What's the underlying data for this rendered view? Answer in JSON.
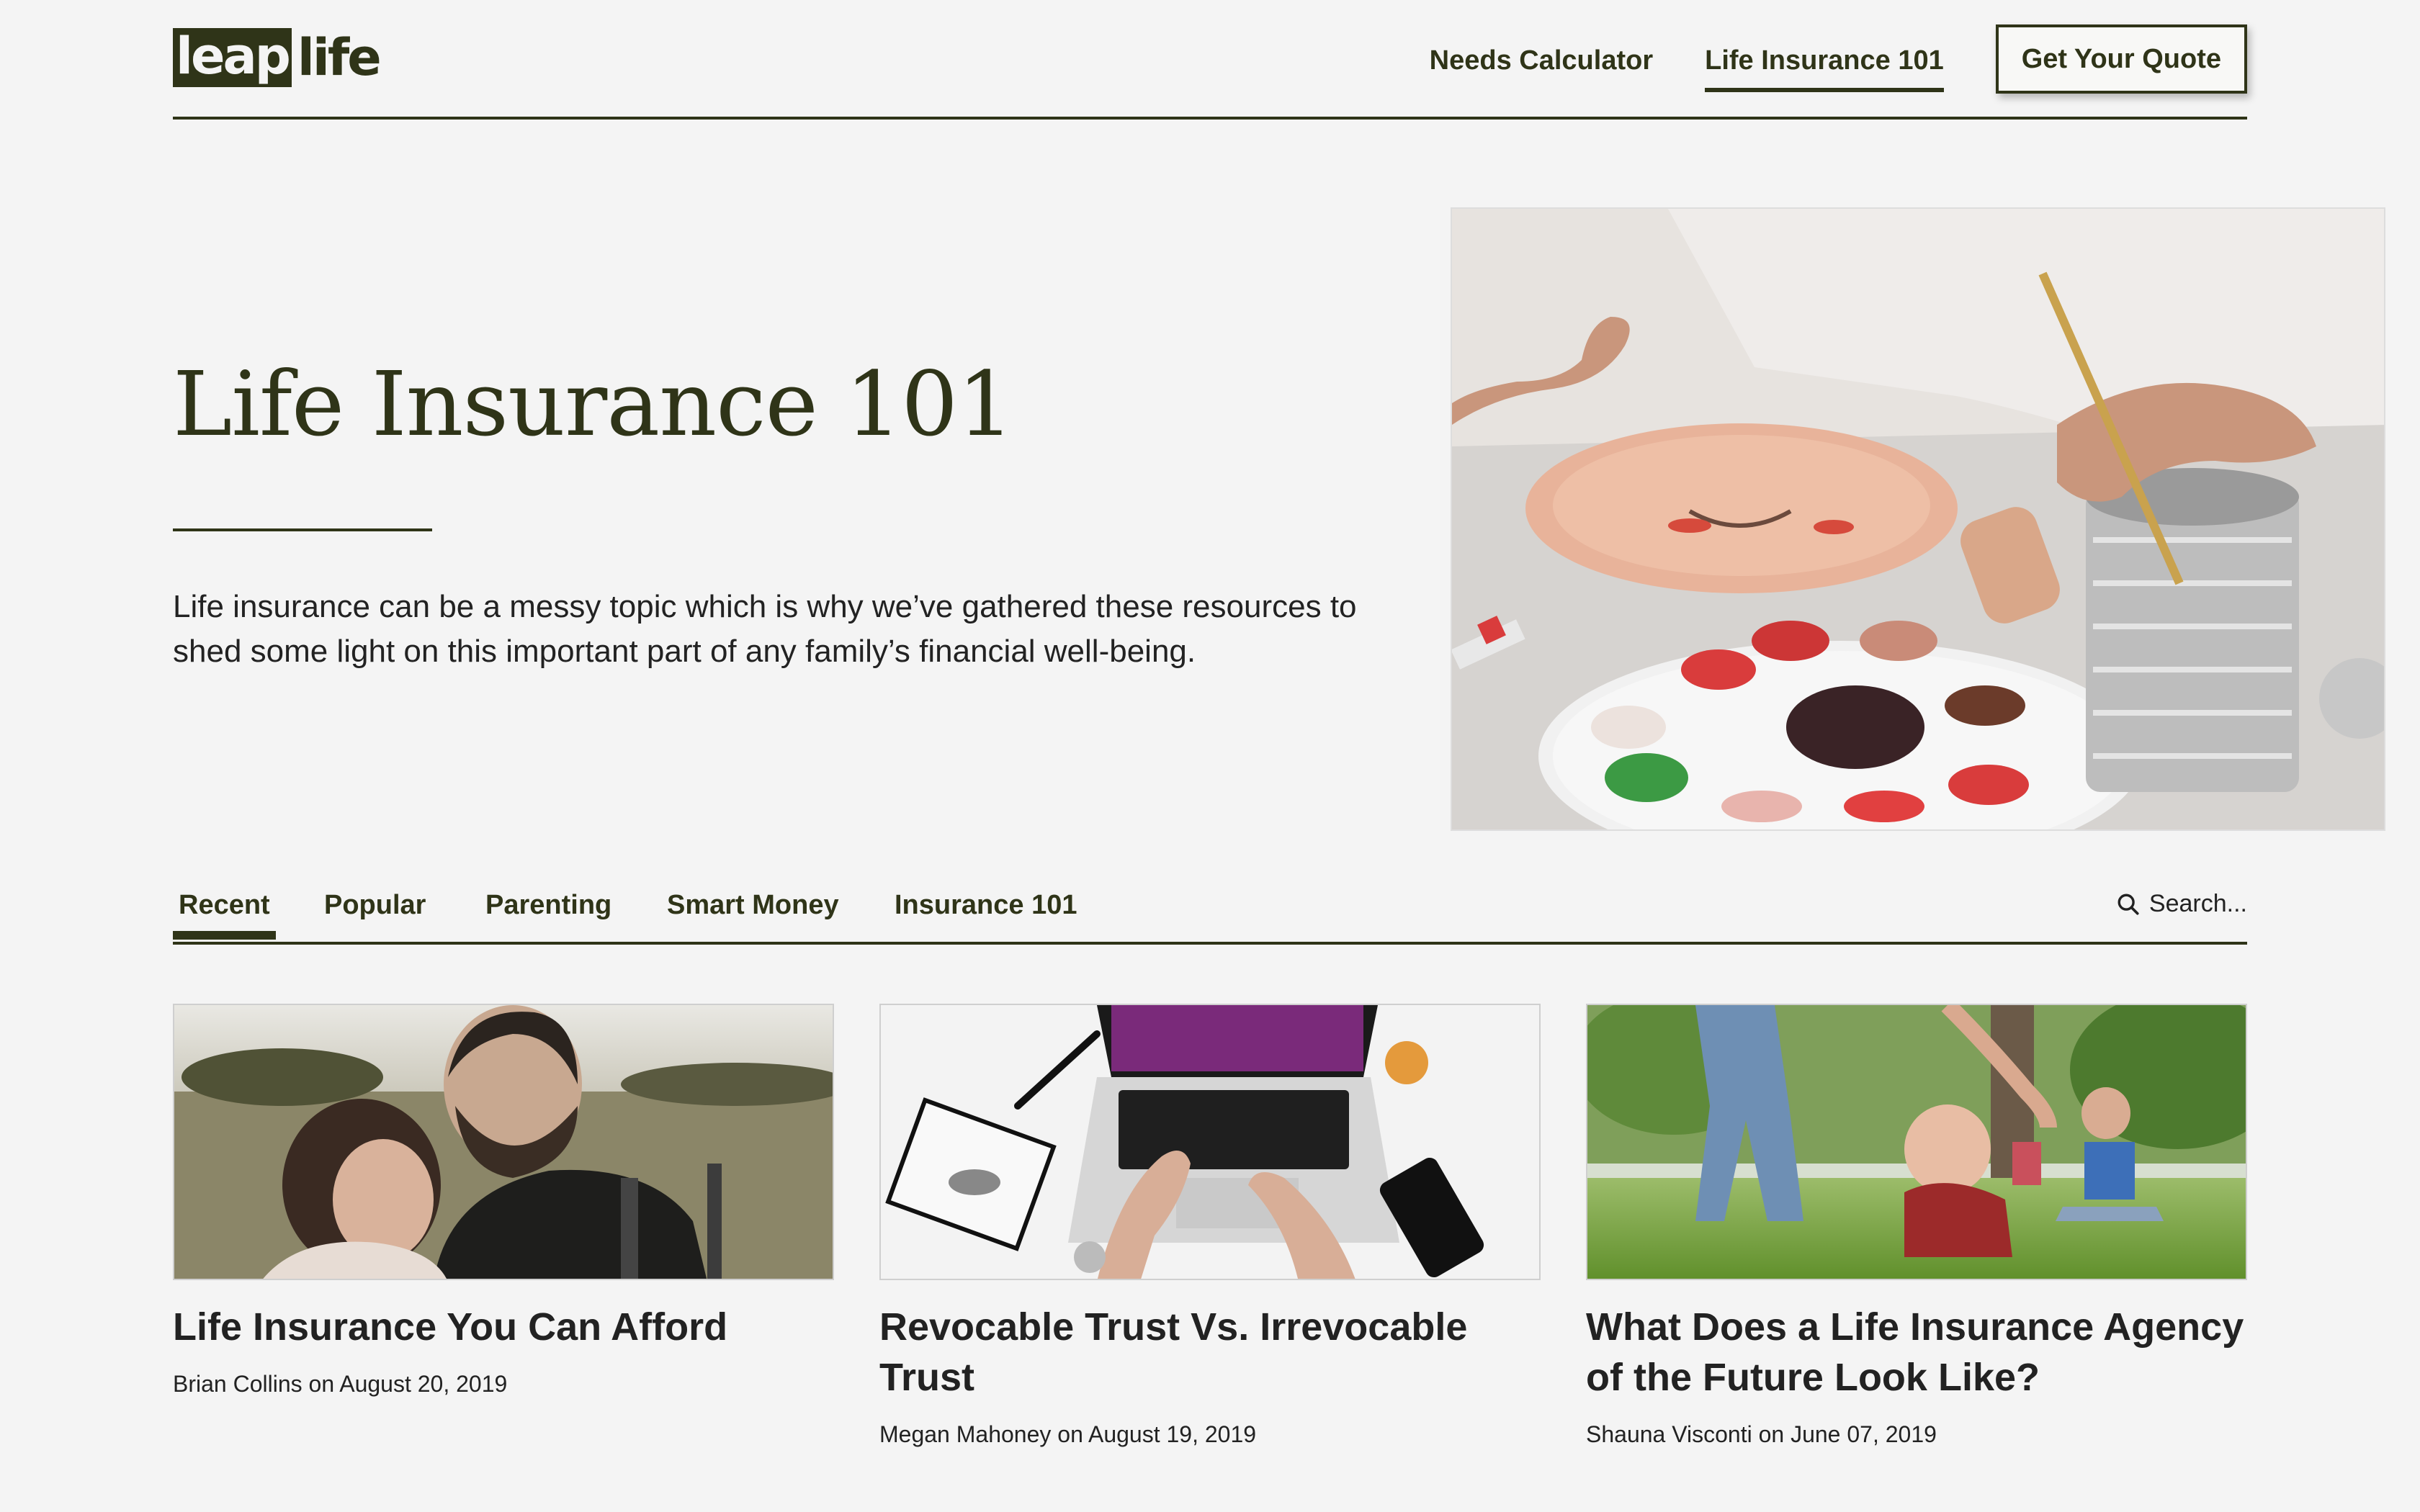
{
  "brand": {
    "logo_part1": "leap",
    "logo_part2": "life"
  },
  "nav": {
    "items": [
      {
        "label": "Needs Calculator"
      },
      {
        "label": "Life Insurance 101",
        "active": true
      }
    ],
    "cta": "Get Your Quote"
  },
  "hero": {
    "title": "Life Insurance 101",
    "description": "Life insurance can be a messy topic which is why we’ve gathered these resources to shed some light on this important part of any family’s financial well-being."
  },
  "tabs": {
    "items": [
      "Recent",
      "Popular",
      "Parenting",
      "Smart Money",
      "Insurance 101"
    ],
    "active": "Recent",
    "search_placeholder": "Search..."
  },
  "articles": [
    {
      "title": "Life Insurance You Can Afford",
      "author": "Brian Collins",
      "date": "August 20, 2019",
      "meta": "Brian Collins on August 20, 2019"
    },
    {
      "title": "Revocable Trust Vs. Irrevocable Trust",
      "author": "Megan Mahoney",
      "date": "August 19, 2019",
      "meta": "Megan Mahoney on August 19, 2019"
    },
    {
      "title": "What Does a Life Insurance Agency of the Future Look Like?",
      "author": "Shauna Visconti",
      "date": "June 07, 2019",
      "meta": "Shauna Visconti on June 07, 2019"
    }
  ],
  "colors": {
    "brand": "#2f3418",
    "background": "#f4f4f4"
  }
}
